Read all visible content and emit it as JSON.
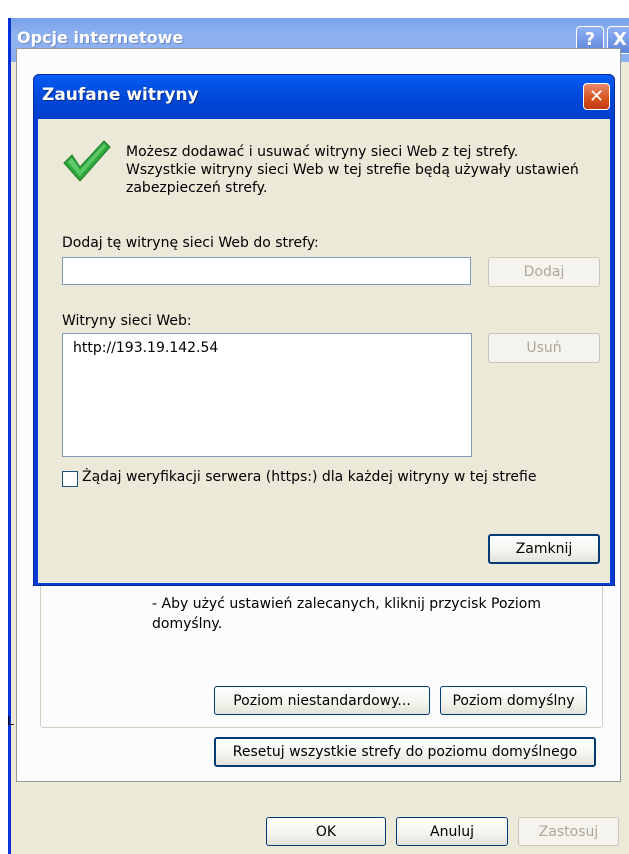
{
  "outer_window": {
    "title": "Opcje internetowe",
    "help_glyph": "?",
    "close_glyph": "X",
    "recommend_text": "- Aby użyć ustawień zalecanych, kliknij przycisk Poziom domyślny.",
    "custom_level_label": "Poziom niestandardowy...",
    "default_level_label": "Poziom domyślny",
    "reset_label": "Resetuj wszystkie strefy do poziomu domyślnego",
    "ok_label": "OK",
    "cancel_label": "Anuluj",
    "apply_label": "Zastosuj",
    "stray_text": "L"
  },
  "dialog": {
    "title": "Zaufane witryny",
    "close_glyph": "✕",
    "intro_text": "Możesz dodawać i usuwać witryny sieci Web z tej strefy. Wszystkie witryny sieci Web w tej strefie będą używały ustawień zabezpieczeń strefy.",
    "add_label": "Dodaj tę witrynę sieci Web do strefy:",
    "add_input_value": "",
    "add_button": "Dodaj",
    "sites_label": "Witryny sieci Web:",
    "sites": [
      "http://193.19.142.54"
    ],
    "remove_button": "Usuń",
    "https_checkbox_label": "Żądaj weryfikacji serwera (https:) dla każdej witryny w tej strefie",
    "https_checked": false,
    "close_button": "Zamknij"
  },
  "icons": {
    "check": "checkmark-icon"
  },
  "colors": {
    "xp_blue": "#0a3bd6",
    "dialog_face": "#ece9d8",
    "check_green": "#2faa3c",
    "close_red": "#d8501d"
  }
}
